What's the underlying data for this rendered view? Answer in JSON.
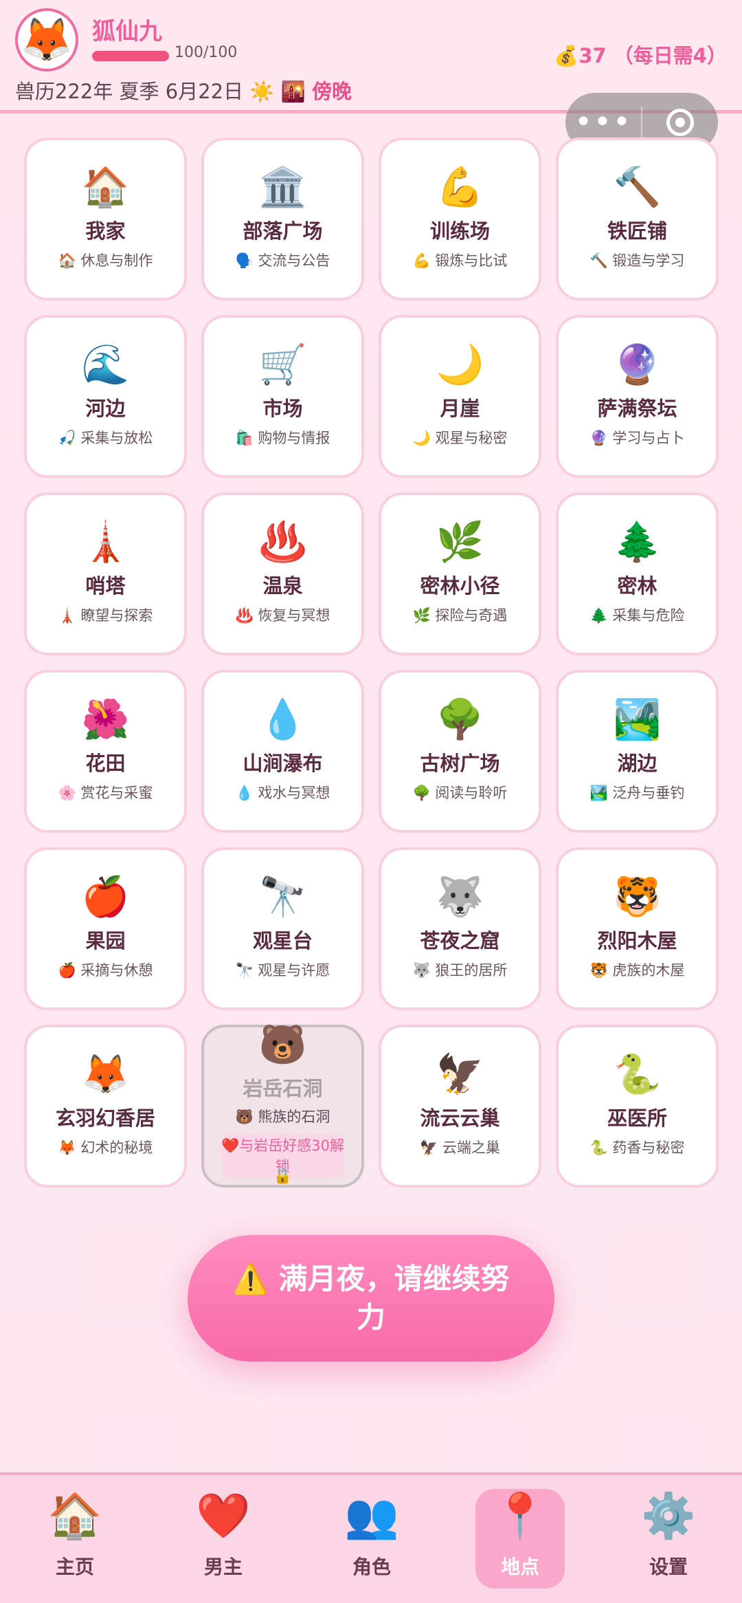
{
  "header": {
    "avatar_icon": "🦊",
    "player_name": "狐仙九",
    "hp_text": "100/100",
    "hp_value": 1.0,
    "date_text": "兽历222年 夏季 6月22日",
    "weather_icon": "☀️",
    "time_icon": "🌇",
    "time_label": "傍晚",
    "money_icon": "💰",
    "money_text": "37 （每日需4）"
  },
  "capsule": {
    "more_icon": "•••",
    "close_icon": "target-icon"
  },
  "locations": [
    {
      "icon": "🏠",
      "name": "我家",
      "desc_icon": "🏠",
      "desc": "休息与制作"
    },
    {
      "icon": "🏛️",
      "name": "部落广场",
      "desc_icon": "🗣️",
      "desc": "交流与公告"
    },
    {
      "icon": "💪",
      "name": "训练场",
      "desc_icon": "💪",
      "desc": "锻炼与比试"
    },
    {
      "icon": "🔨",
      "name": "铁匠铺",
      "desc_icon": "🔨",
      "desc": "锻造与学习"
    },
    {
      "icon": "🌊",
      "name": "河边",
      "desc_icon": "🎣",
      "desc": "采集与放松"
    },
    {
      "icon": "🛒",
      "name": "市场",
      "desc_icon": "🛍️",
      "desc": "购物与情报"
    },
    {
      "icon": "🌙",
      "name": "月崖",
      "desc_icon": "🌙",
      "desc": "观星与秘密"
    },
    {
      "icon": "🔮",
      "name": "萨满祭坛",
      "desc_icon": "🔮",
      "desc": "学习与占卜"
    },
    {
      "icon": "🗼",
      "name": "哨塔",
      "desc_icon": "🗼",
      "desc": "瞭望与探索"
    },
    {
      "icon": "♨️",
      "name": "温泉",
      "desc_icon": "♨️",
      "desc": "恢复与冥想"
    },
    {
      "icon": "🌿",
      "name": "密林小径",
      "desc_icon": "🌿",
      "desc": "探险与奇遇"
    },
    {
      "icon": "🌲",
      "name": "密林",
      "desc_icon": "🌲",
      "desc": "采集与危险"
    },
    {
      "icon": "🌺",
      "name": "花田",
      "desc_icon": "🌸",
      "desc": "赏花与采蜜"
    },
    {
      "icon": "💧",
      "name": "山涧瀑布",
      "desc_icon": "💧",
      "desc": "戏水与冥想"
    },
    {
      "icon": "🌳",
      "name": "古树广场",
      "desc_icon": "🌳",
      "desc": "阅读与聆听"
    },
    {
      "icon": "🏞️",
      "name": "湖边",
      "desc_icon": "🏞️",
      "desc": "泛舟与垂钓"
    },
    {
      "icon": "🍎",
      "name": "果园",
      "desc_icon": "🍎",
      "desc": "采摘与休憩"
    },
    {
      "icon": "🔭",
      "name": "观星台",
      "desc_icon": "🔭",
      "desc": "观星与许愿"
    },
    {
      "icon": "🐺",
      "name": "苍夜之窟",
      "desc_icon": "🐺",
      "desc": "狼王的居所"
    },
    {
      "icon": "🐯",
      "name": "烈阳木屋",
      "desc_icon": "🐯",
      "desc": "虎族的木屋"
    },
    {
      "icon": "🦊",
      "name": "玄羽幻香居",
      "desc_icon": "🦊",
      "desc": "幻术的秘境"
    },
    {
      "icon": "🐻",
      "name": "岩岳石洞",
      "desc_icon": "🐻",
      "desc": "熊族的石洞",
      "locked": true,
      "lock_hint": "❤️与岩岳好感30解锁",
      "lock_icon": "🔒"
    },
    {
      "icon": "🦅",
      "name": "流云云巢",
      "desc_icon": "🦅",
      "desc": "云端之巢"
    },
    {
      "icon": "🐍",
      "name": "巫医所",
      "desc_icon": "🐍",
      "desc": "药香与秘密"
    }
  ],
  "warning_button": {
    "icon": "⚠️",
    "label": "满月夜，请继续努力"
  },
  "nav": [
    {
      "icon": "🏠",
      "label": "主页",
      "active": false
    },
    {
      "icon": "❤️",
      "label": "男主",
      "active": false
    },
    {
      "icon": "👥",
      "label": "角色",
      "active": false
    },
    {
      "icon": "📍",
      "label": "地点",
      "active": true
    },
    {
      "icon": "⚙️",
      "label": "设置",
      "active": false
    }
  ],
  "colors": {
    "accent": "#ee5f9c",
    "tile_border": "#f9cfe0",
    "nav_bg": "#fbd7e6"
  }
}
